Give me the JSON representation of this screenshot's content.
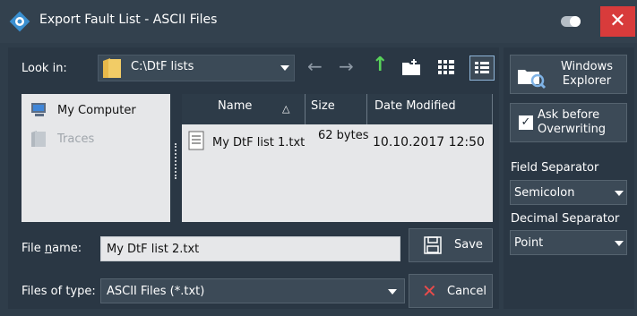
{
  "window": {
    "title": "Export Fault List - ASCII Files"
  },
  "look_in": {
    "label": "Look in:",
    "path": "C:\\DtF lists"
  },
  "places": [
    {
      "label": "My Computer",
      "enabled": true
    },
    {
      "label": "Traces",
      "enabled": false
    }
  ],
  "columns": {
    "name": "Name",
    "size": "Size",
    "date": "Date Modified",
    "sort_indicator": "△"
  },
  "files": [
    {
      "name": "My DtF list 1.txt",
      "size": "62 bytes",
      "date": "10.10.2017 12:50"
    }
  ],
  "file_name": {
    "label": "File name:",
    "value": "My DtF list 2.txt"
  },
  "file_type": {
    "label": "Files of type:",
    "value": "ASCII Files (*.txt)"
  },
  "buttons": {
    "save": "Save",
    "cancel": "Cancel",
    "windows_explorer_1": "Windows",
    "windows_explorer_2": "Explorer",
    "ask_1": "Ask before",
    "ask_2": "Overwriting"
  },
  "ask_before_overwriting": true,
  "field_separator": {
    "label": "Field Separator",
    "value": "Semicolon"
  },
  "decimal_separator": {
    "label": "Decimal Separator",
    "value": "Point"
  },
  "colors": {
    "accent_up_arrow": "#58d25a",
    "close": "#d83b3b"
  }
}
